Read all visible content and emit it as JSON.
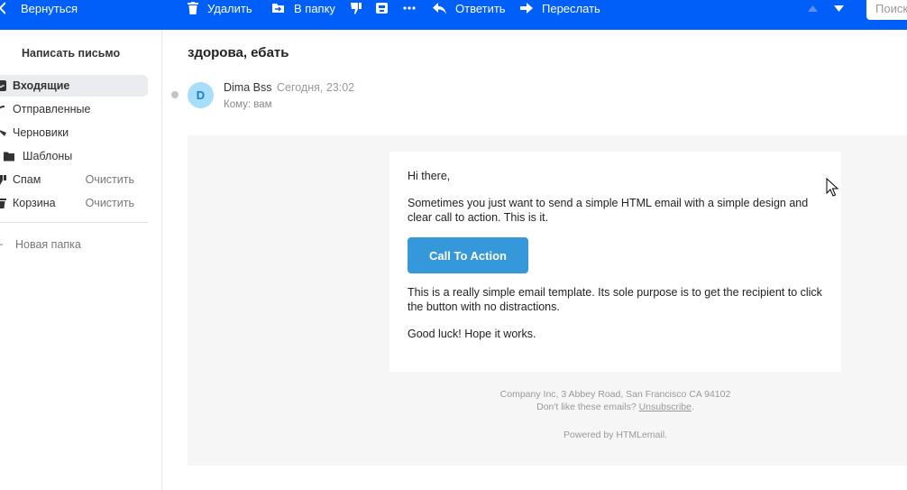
{
  "toolbar": {
    "back_label": "Вернуться",
    "delete_label": "Удалить",
    "move_label": "В папку",
    "reply_label": "Ответить",
    "forward_label": "Переслать",
    "search_placeholder": "Поиск",
    "icons": [
      "back-arrow-icon",
      "trash-icon",
      "move-to-folder-icon",
      "dislike-icon",
      "archive-icon",
      "more-icon",
      "reply-icon",
      "forward-icon",
      "prev-message-icon",
      "next-message-icon"
    ],
    "background_color": "#005ff9"
  },
  "sidebar": {
    "compose_label": "Написать письмо",
    "folders": [
      {
        "label": "Входящие",
        "icon": "inbox-icon",
        "active": true
      },
      {
        "label": "Отправленные",
        "icon": "sent-icon"
      },
      {
        "label": "Черновики",
        "icon": "drafts-icon"
      },
      {
        "label": "Шаблоны",
        "icon": "folder-icon"
      },
      {
        "label": "Спам",
        "icon": "spam-icon",
        "action": "Очистить"
      },
      {
        "label": "Корзина",
        "icon": "trash-icon",
        "action": "Очистить"
      }
    ],
    "new_folder_label": "Новая папка"
  },
  "message": {
    "subject": "здорова, ебать",
    "avatar_letter": "D",
    "sender_name": "Dima Bss",
    "time": "Сегодня, 23:02",
    "recipient": "Кому: вам"
  },
  "email": {
    "greeting": "Hi there,",
    "intro": "Sometimes you just want to send a simple HTML email with a simple design and clear call to action. This is it.",
    "cta_label": "Call To Action",
    "body": "This is a really simple email template. Its sole purpose is to get the recipient to click the button with no distractions.",
    "closing": "Good luck! Hope it works.",
    "footer_address": "Company Inc, 3 Abbey Road, San Francisco CA 94102",
    "footer_dont_like": "Don't like these emails?",
    "footer_unsubscribe": "Unsubscribe",
    "footer_period": ".",
    "footer_powered": "Powered by HTMLemail.",
    "cta_color": "#3498db"
  }
}
